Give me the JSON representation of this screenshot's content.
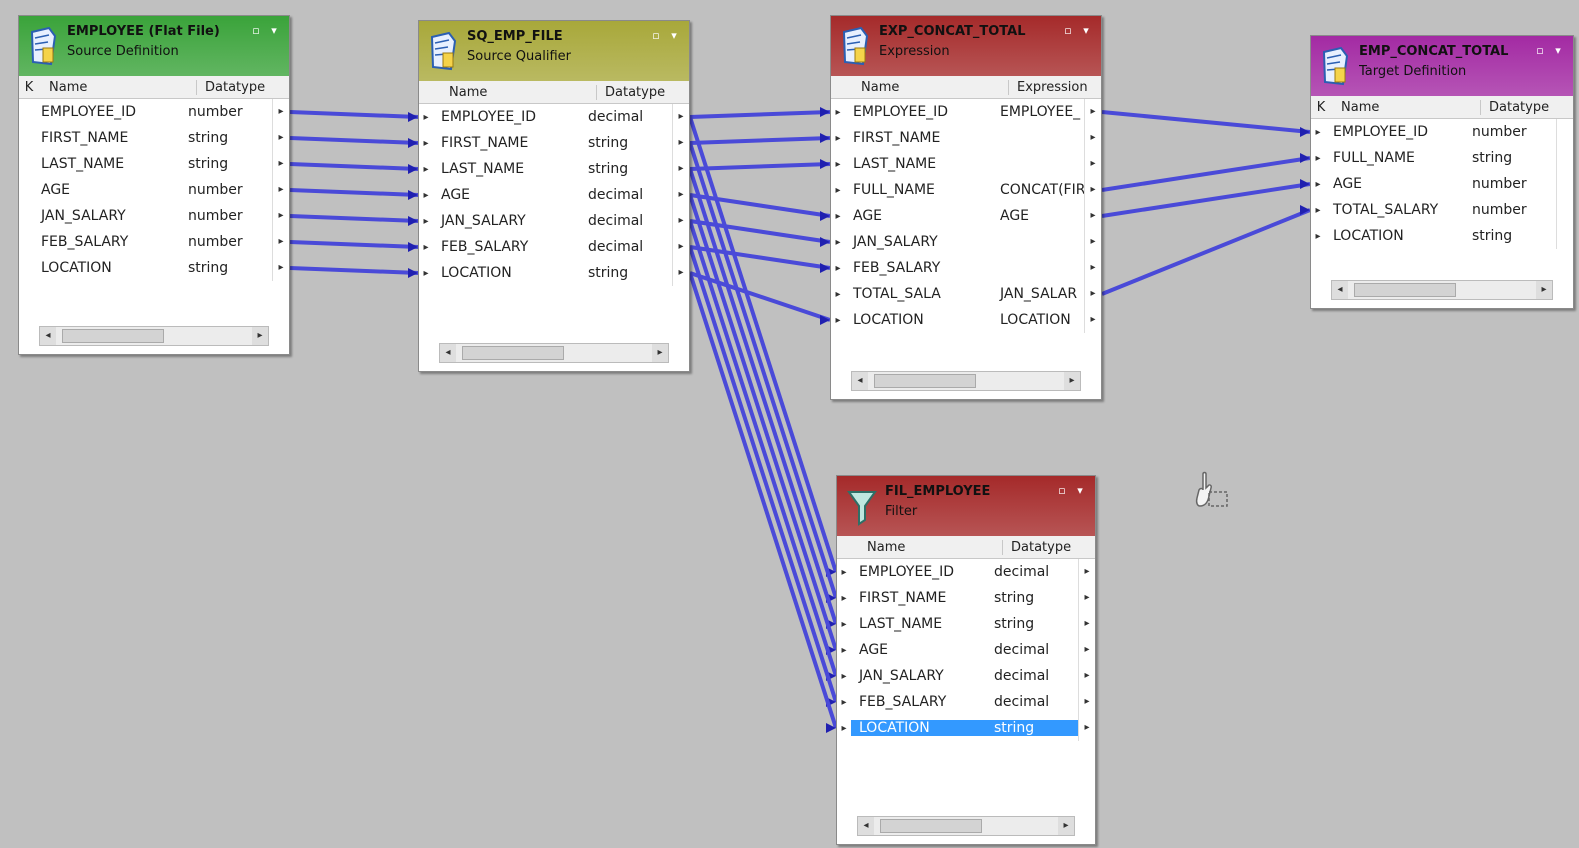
{
  "transforms": [
    {
      "id": "src",
      "title": "EMPLOYEE (Flat File)",
      "subtitle": "Source Definition",
      "header_color": "#3aa33a",
      "columns": {
        "key": "K",
        "name": "Name",
        "second": "Datatype"
      },
      "rows": [
        {
          "name": "EMPLOYEE_ID",
          "value": "number"
        },
        {
          "name": "FIRST_NAME",
          "value": "string"
        },
        {
          "name": "LAST_NAME",
          "value": "string"
        },
        {
          "name": "AGE",
          "value": "number"
        },
        {
          "name": "JAN_SALARY",
          "value": "number"
        },
        {
          "name": "FEB_SALARY",
          "value": "number"
        },
        {
          "name": "LOCATION",
          "value": "string"
        }
      ]
    },
    {
      "id": "sq",
      "title": "SQ_EMP_FILE",
      "subtitle": "Source Qualifier",
      "header_color": "#a8a83a",
      "columns": {
        "key": "",
        "name": "Name",
        "second": "Datatype"
      },
      "rows": [
        {
          "name": "EMPLOYEE_ID",
          "value": "decimal"
        },
        {
          "name": "FIRST_NAME",
          "value": "string"
        },
        {
          "name": "LAST_NAME",
          "value": "string"
        },
        {
          "name": "AGE",
          "value": "decimal"
        },
        {
          "name": "JAN_SALARY",
          "value": "decimal"
        },
        {
          "name": "FEB_SALARY",
          "value": "decimal"
        },
        {
          "name": "LOCATION",
          "value": "string"
        }
      ]
    },
    {
      "id": "exp",
      "title": "EXP_CONCAT_TOTAL",
      "subtitle": "Expression",
      "header_color": "#a52a2a",
      "columns": {
        "key": "",
        "name": "Name",
        "second": "Expression"
      },
      "rows": [
        {
          "name": "EMPLOYEE_ID",
          "value": "EMPLOYEE_"
        },
        {
          "name": "FIRST_NAME",
          "value": ""
        },
        {
          "name": "LAST_NAME",
          "value": ""
        },
        {
          "name": "FULL_NAME",
          "value": "CONCAT(FIR"
        },
        {
          "name": "AGE",
          "value": "AGE"
        },
        {
          "name": "JAN_SALARY",
          "value": ""
        },
        {
          "name": "FEB_SALARY",
          "value": ""
        },
        {
          "name": "TOTAL_SALA",
          "value": "JAN_SALAR"
        },
        {
          "name": "LOCATION",
          "value": "LOCATION"
        }
      ]
    },
    {
      "id": "tgt",
      "title": "EMP_CONCAT_TOTAL",
      "subtitle": "Target Definition",
      "header_color": "#a32aa3",
      "columns": {
        "key": "K",
        "name": "Name",
        "second": "Datatype"
      },
      "rows": [
        {
          "name": "EMPLOYEE_ID",
          "value": "number"
        },
        {
          "name": "FULL_NAME",
          "value": "string"
        },
        {
          "name": "AGE",
          "value": "number"
        },
        {
          "name": "TOTAL_SALARY",
          "value": "number"
        },
        {
          "name": "LOCATION",
          "value": "string"
        }
      ]
    },
    {
      "id": "fil",
      "title": "FIL_EMPLOYEE",
      "subtitle": "Filter",
      "header_color": "#a52a2a",
      "columns": {
        "key": "",
        "name": "Name",
        "second": "Datatype"
      },
      "rows": [
        {
          "name": "EMPLOYEE_ID",
          "value": "decimal"
        },
        {
          "name": "FIRST_NAME",
          "value": "string"
        },
        {
          "name": "LAST_NAME",
          "value": "string"
        },
        {
          "name": "AGE",
          "value": "decimal"
        },
        {
          "name": "JAN_SALARY",
          "value": "decimal"
        },
        {
          "name": "FEB_SALARY",
          "value": "decimal"
        },
        {
          "name": "LOCATION",
          "value": "string",
          "selected": true
        }
      ]
    }
  ],
  "links": [
    {
      "from": "src",
      "from_row": 0,
      "to": "sq",
      "to_row": 0
    },
    {
      "from": "src",
      "from_row": 1,
      "to": "sq",
      "to_row": 1
    },
    {
      "from": "src",
      "from_row": 2,
      "to": "sq",
      "to_row": 2
    },
    {
      "from": "src",
      "from_row": 3,
      "to": "sq",
      "to_row": 3
    },
    {
      "from": "src",
      "from_row": 4,
      "to": "sq",
      "to_row": 4
    },
    {
      "from": "src",
      "from_row": 5,
      "to": "sq",
      "to_row": 5
    },
    {
      "from": "src",
      "from_row": 6,
      "to": "sq",
      "to_row": 6
    },
    {
      "from": "sq",
      "from_row": 0,
      "to": "exp",
      "to_row": 0
    },
    {
      "from": "sq",
      "from_row": 1,
      "to": "exp",
      "to_row": 1
    },
    {
      "from": "sq",
      "from_row": 2,
      "to": "exp",
      "to_row": 2
    },
    {
      "from": "sq",
      "from_row": 3,
      "to": "exp",
      "to_row": 4
    },
    {
      "from": "sq",
      "from_row": 4,
      "to": "exp",
      "to_row": 5
    },
    {
      "from": "sq",
      "from_row": 5,
      "to": "exp",
      "to_row": 6
    },
    {
      "from": "sq",
      "from_row": 6,
      "to": "exp",
      "to_row": 8
    },
    {
      "from": "sq",
      "from_row": 0,
      "to": "fil",
      "to_row": 0
    },
    {
      "from": "sq",
      "from_row": 1,
      "to": "fil",
      "to_row": 1
    },
    {
      "from": "sq",
      "from_row": 2,
      "to": "fil",
      "to_row": 2
    },
    {
      "from": "sq",
      "from_row": 3,
      "to": "fil",
      "to_row": 3
    },
    {
      "from": "sq",
      "from_row": 4,
      "to": "fil",
      "to_row": 4
    },
    {
      "from": "sq",
      "from_row": 5,
      "to": "fil",
      "to_row": 5
    },
    {
      "from": "sq",
      "from_row": 6,
      "to": "fil",
      "to_row": 6
    },
    {
      "from": "exp",
      "from_row": 0,
      "to": "tgt",
      "to_row": 0
    },
    {
      "from": "exp",
      "from_row": 3,
      "to": "tgt",
      "to_row": 1
    },
    {
      "from": "exp",
      "from_row": 4,
      "to": "tgt",
      "to_row": 2
    },
    {
      "from": "exp",
      "from_row": 7,
      "to": "tgt",
      "to_row": 3
    }
  ],
  "link_color": "#4a4ad8",
  "icons": {
    "transform_icon": "document-icon",
    "filter_icon": "funnel-icon",
    "cursor": "drag-cursor-icon"
  }
}
